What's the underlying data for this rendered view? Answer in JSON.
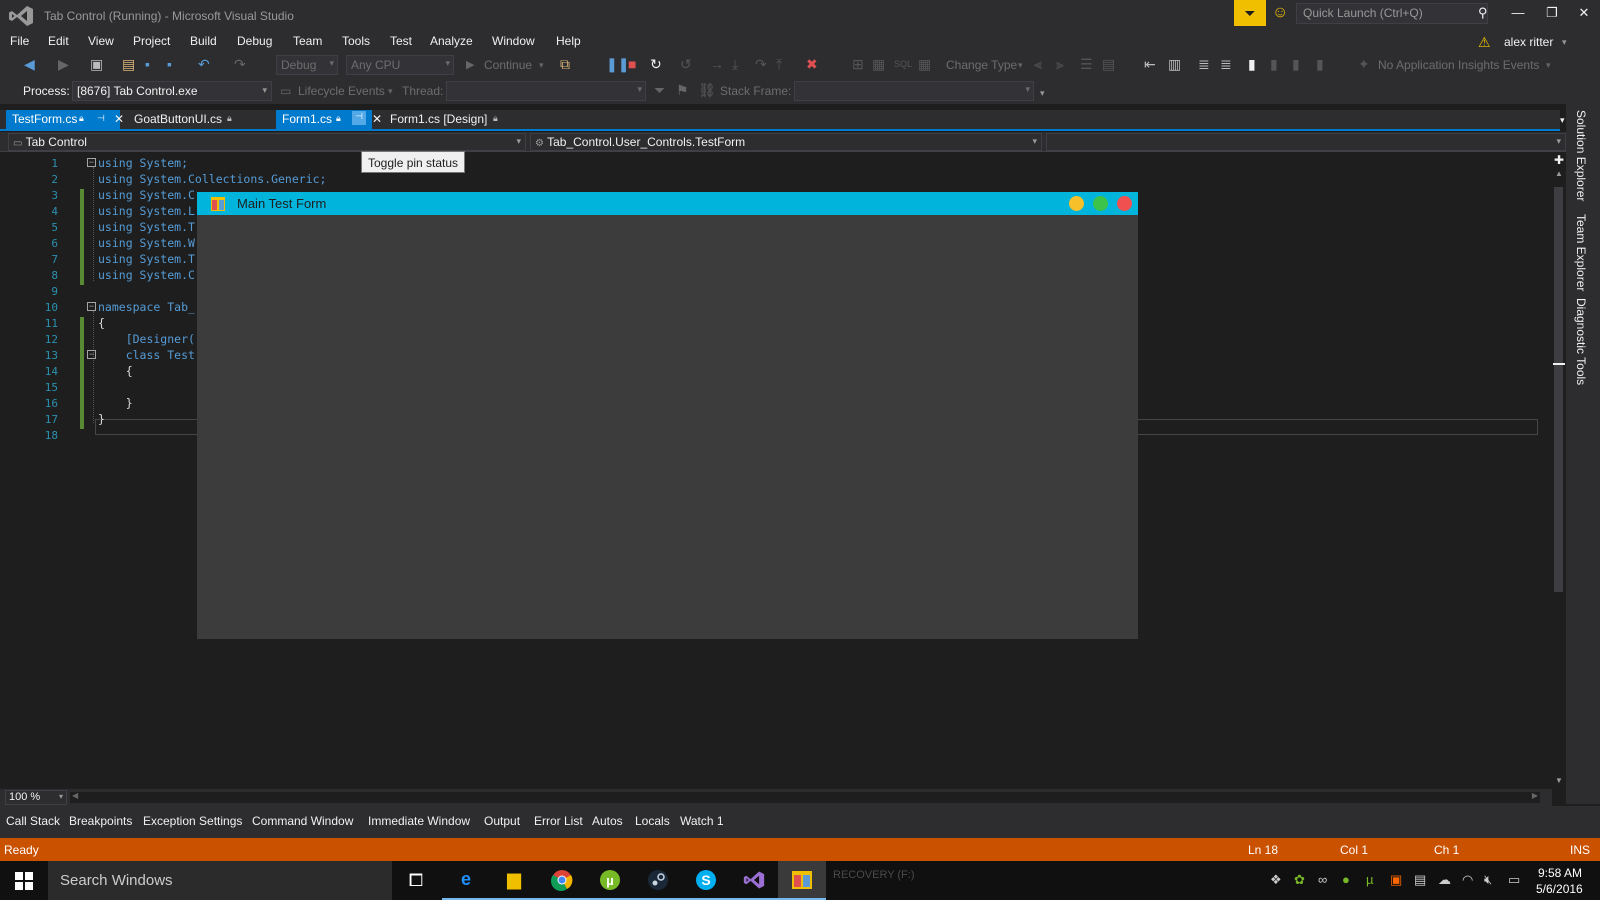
{
  "window": {
    "title": "Tab Control (Running) - Microsoft Visual Studio",
    "quick_launch_placeholder": "Quick Launch (Ctrl+Q)",
    "user": "alex ritter"
  },
  "menu": [
    "File",
    "Edit",
    "View",
    "Project",
    "Build",
    "Debug",
    "Team",
    "Tools",
    "Test",
    "Analyze",
    "Window",
    "Help"
  ],
  "toolbar": {
    "config": "Debug",
    "platform": "Any CPU",
    "continue": "Continue",
    "change_type": "Change Type",
    "insights": "No Application Insights Events",
    "process_label": "Process:",
    "process_value": "[8676] Tab Control.exe",
    "lifecycle": "Lifecycle Events",
    "thread_label": "Thread:",
    "stack_frame_label": "Stack Frame:"
  },
  "tabs": [
    {
      "label": "TestForm.cs"
    },
    {
      "label": "GoatButtonUI.cs"
    },
    {
      "label": "Form1.cs"
    },
    {
      "label": "Form1.cs [Design]"
    }
  ],
  "navbar": {
    "project": "Tab Control",
    "type": "Tab_Control.User_Controls.TestForm"
  },
  "tooltip": "Toggle pin status",
  "editor": {
    "line_numbers": [
      "1",
      "2",
      "3",
      "4",
      "5",
      "6",
      "7",
      "8",
      "9",
      "10",
      "11",
      "12",
      "13",
      "14",
      "15",
      "16",
      "17",
      "18"
    ],
    "lines": [
      "using System;",
      "using System.Collections.Generic;",
      "using System.C",
      "using System.L",
      "using System.T",
      "using System.W",
      "using System.T",
      "using System.C",
      "",
      "namespace Tab_",
      "{",
      "    [Designer(",
      "    class Test",
      "    {",
      "",
      "    }",
      "}",
      ""
    ],
    "zoom": "100 %"
  },
  "side_tabs": [
    "Solution Explorer",
    "Team Explorer",
    "Diagnostic Tools"
  ],
  "tool_tabs": [
    "Call Stack",
    "Breakpoints",
    "Exception Settings",
    "Command Window",
    "Immediate Window",
    "Output",
    "Error List",
    "Autos",
    "Locals",
    "Watch 1"
  ],
  "status": {
    "state": "Ready",
    "ln": "Ln 18",
    "col": "Col 1",
    "ch": "Ch 1",
    "ins": "INS"
  },
  "form": {
    "title": "Main Test Form"
  },
  "taskbar": {
    "search_placeholder": "Search Windows",
    "recovery": "RECOVERY (F:)",
    "time": "9:58 AM",
    "date": "5/6/2016"
  },
  "colors": {
    "status_bar": "#ca5100",
    "accent": "#007acc",
    "form_title": "#00b4dc"
  }
}
